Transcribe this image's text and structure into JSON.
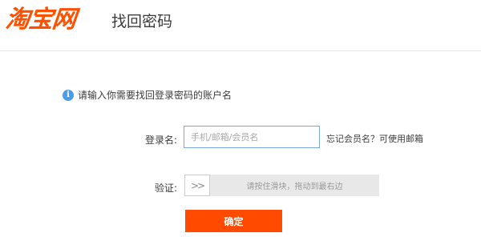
{
  "header": {
    "logo_text": "淘宝网",
    "title": "找回密码"
  },
  "tip": {
    "icon": "info-icon",
    "text": "请输入你需要找回登录密码的账户名"
  },
  "form": {
    "account_label": "登录名:",
    "account_placeholder": "手机/邮箱/会员名",
    "account_value": "",
    "forgot_hint": "忘记会员名？可使用邮箱",
    "verify_label": "验证:",
    "slider_handle_symbol": "»",
    "slider_text": "请按住滑块，拖动到最右边",
    "confirm_label": "确定"
  },
  "colors": {
    "brand": "#ff5000",
    "button": "#ff4a00",
    "info": "#4a9be8"
  }
}
